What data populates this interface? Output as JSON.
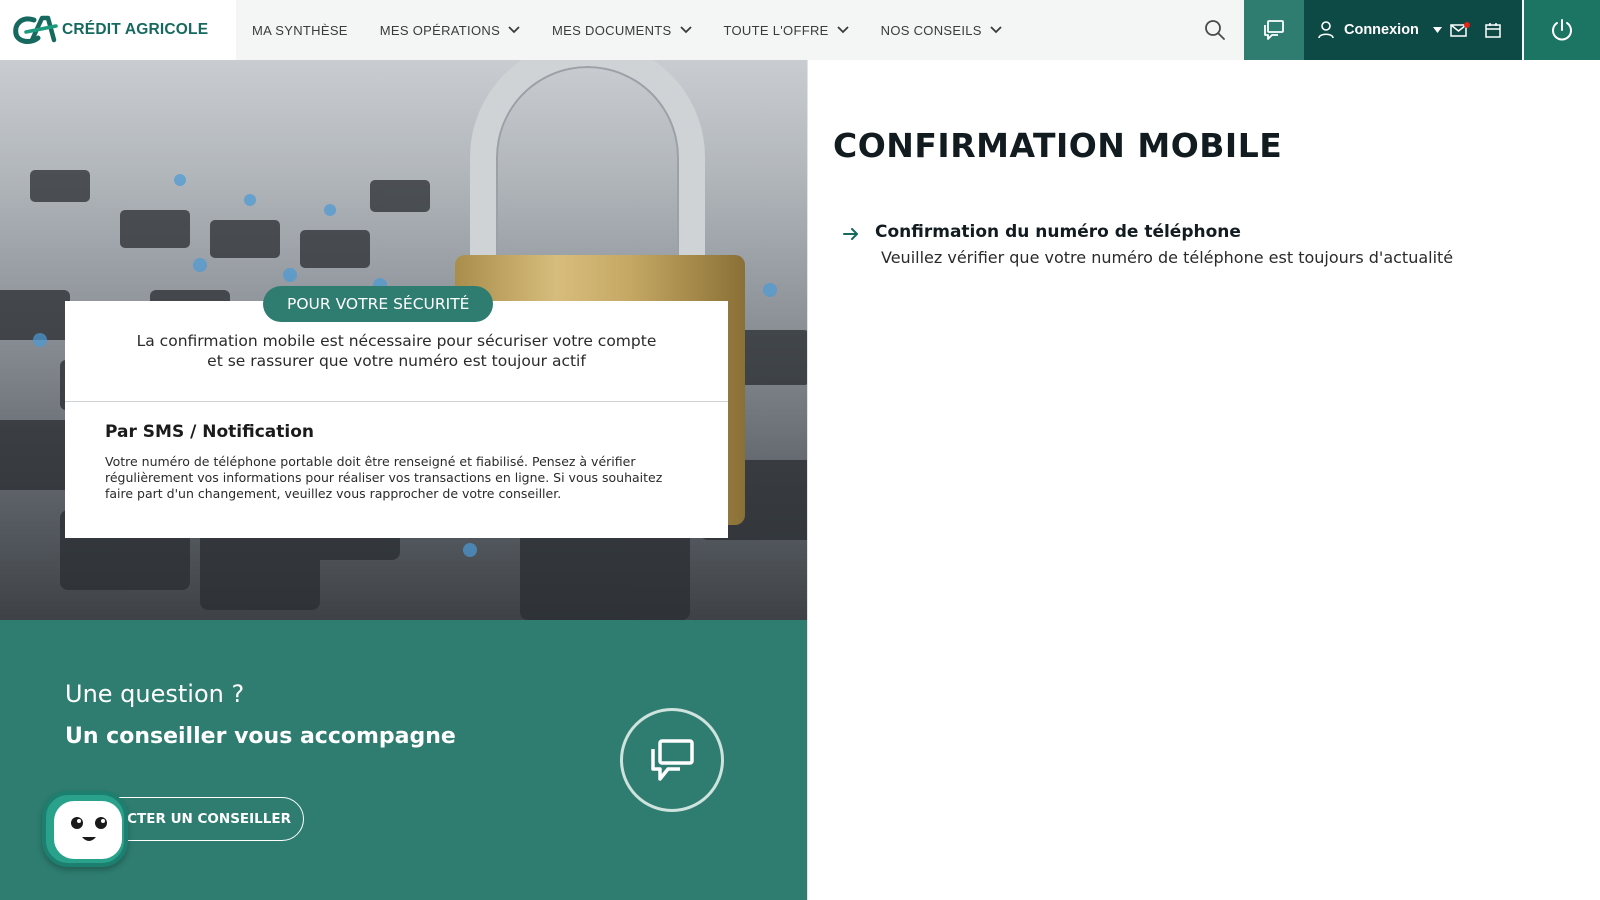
{
  "brand": {
    "name": "CRÉDIT AGRICOLE",
    "color": "#16695f",
    "accent": "#2e7d70",
    "dark": "#0d4a45"
  },
  "nav": {
    "items": [
      {
        "label": "MA SYNTHÈSE",
        "has_dropdown": false
      },
      {
        "label": "MES OPÉRATIONS",
        "has_dropdown": true
      },
      {
        "label": "MES DOCUMENTS",
        "has_dropdown": true
      },
      {
        "label": "TOUTE L'OFFRE",
        "has_dropdown": true
      },
      {
        "label": "NOS CONSEILS",
        "has_dropdown": true
      }
    ]
  },
  "header": {
    "search_icon": "search-icon",
    "chat_icon": "chat-icon",
    "account_label": "Connexion",
    "mail_icon": "mail-icon",
    "calendar_icon": "calendar-icon",
    "power_icon": "power-icon"
  },
  "hero": {
    "badge": "POUR VOTRE SÉCURITÉ",
    "intro_line1": "La confirmation mobile est nécessaire pour sécuriser votre compte",
    "intro_line2": "et se rassurer que votre numéro est toujour actif",
    "method_title": "Par SMS / Notification",
    "method_text": "Votre numéro de téléphone portable doit être renseigné et fiabilisé. Pensez à vérifier régulièrement vos informations pour réaliser vos transactions en ligne. Si vous souhaitez faire part d'un changement, veuillez vous rapprocher de votre conseiller."
  },
  "cta": {
    "question": "Une question ?",
    "subtitle": "Un conseiller vous accompagne",
    "button_label": "CONTACTER UN CONSEILLER"
  },
  "main": {
    "title": "CONFIRMATION MOBILE",
    "step_title": "Confirmation du numéro de téléphone",
    "step_desc": "Veuillez vérifier que votre numéro de téléphone est toujours d'actualité"
  }
}
